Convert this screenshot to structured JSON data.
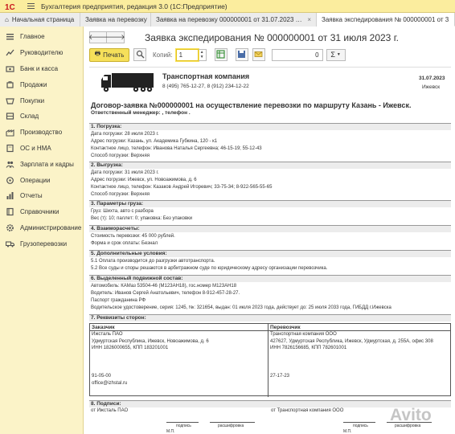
{
  "app": {
    "title": "Бухгалтерия предприятия, редакция 3.0  (1С:Предприятие)"
  },
  "tabs": [
    {
      "label": "Начальная страница",
      "closable": false
    },
    {
      "label": "Заявка на перевозку",
      "closable": true
    },
    {
      "label": "Заявка на перевозку 000000001 от 31.07.2023 14:57:45",
      "closable": true
    },
    {
      "label": "Заявка экспедирования № 000000001 от 31 июля 2023 г.",
      "closable": true
    }
  ],
  "sidebar": {
    "items": [
      {
        "label": "Главное",
        "icon": "menu-icon"
      },
      {
        "label": "Руководителю",
        "icon": "chart-icon"
      },
      {
        "label": "Банк и касса",
        "icon": "bank-icon"
      },
      {
        "label": "Продажи",
        "icon": "cart-icon"
      },
      {
        "label": "Покупки",
        "icon": "basket-icon"
      },
      {
        "label": "Склад",
        "icon": "warehouse-icon"
      },
      {
        "label": "Производство",
        "icon": "factory-icon"
      },
      {
        "label": "ОС и НМА",
        "icon": "building-icon"
      },
      {
        "label": "Зарплата и кадры",
        "icon": "people-icon"
      },
      {
        "label": "Операции",
        "icon": "operations-icon"
      },
      {
        "label": "Отчеты",
        "icon": "report-icon"
      },
      {
        "label": "Справочники",
        "icon": "book-icon"
      },
      {
        "label": "Администрирование",
        "icon": "gear-icon"
      },
      {
        "label": "Грузоперевозки",
        "icon": "truck-icon"
      }
    ]
  },
  "form": {
    "title": "Заявка экспедирования № 000000001 от 31 июля 2023 г.",
    "print_label": "Печать",
    "copies_label": "Копий:",
    "copies_value": "1",
    "sum_value": "0",
    "sigma": "Σ"
  },
  "document": {
    "company_name": "Транспортная компания",
    "company_phones": "8 (495) 765-12-27, 8 (912) 234-12-22",
    "date": "31.07.2023",
    "city": "Ижевск",
    "contract_title": "Договор-заявка №000000001 на осуществление перевозки по маршруту Казань - Ижевск.",
    "manager": "Ответственный менеджер: , телефон .",
    "sections": [
      {
        "title": "1. Погрузка:",
        "lines": [
          "Дата погрузки: 28 июля 2023 г.",
          "Адрес погрузки: Казань, ул. Академика Губкина, 120 - к1",
          "Контактное лицо, телефон: Иванова Наталья Сергеевна; 46-15-19; 55-12-43",
          "Способ погрузки: Верхняя"
        ]
      },
      {
        "title": "2. Выгрузка:",
        "lines": [
          "Дата погрузки: 31 июля 2023 г.",
          "Адрес погрузки: Ижевск, ул. Новоажимова, д. 6",
          "Контактное лицо, телефон: Казаков Андрей Игоревич; 33-75-34; 8-922-565-55-65",
          "Способ погрузки: Верхняя"
        ]
      },
      {
        "title": "3. Параметры груза:",
        "lines": [
          "Груз: Шихта, авто с разбора",
          "Вес (т): 10; паллет: 0; упаковка: Без упаковки"
        ]
      },
      {
        "title": "4. Взаиморасчеты:",
        "lines": [
          "Стоимость перевозки: 45 000 рублей.",
          "Форма и срок оплаты: Безнал"
        ]
      },
      {
        "title": "5. Дополнительные условия:",
        "lines": [
          "5.1 Оплата производится до разгрузки автотранспорта.",
          "5.2 Все суды и споры решаются в арбитражном суде по юридическому адресу организации перевозчика."
        ]
      },
      {
        "title": "6. Выделенный подвижной состав:",
        "lines": [
          "Автомобиль: КАМаз 53504-46 (М123АН18), гос.номер М123АН18",
          "Водитель: Иванов Сергей Анатольевич, телефон 8-912-457-28-27.",
          "Паспорт гражданина РФ",
          "Водительское удостоверение, серия: 1245, №: 321654, выдан: 01 июля 2023 года, действует до: 25 июля 2033 года, ГИБДД г.Ижевска"
        ]
      }
    ],
    "requisites": {
      "title": "7. Реквизиты сторон:",
      "customer": {
        "header": "Заказчик",
        "lines": [
          "Ижсталь ПАО",
          "Удмуртская Республика, Ижевск, Новоажимова, д. 6",
          "ИНН 1826000655, КПП 183201001"
        ],
        "phone": "91-05-00",
        "email": "office@izhstal.ru"
      },
      "carrier": {
        "header": "Перевозчик",
        "lines": [
          "Транспортная компания ООО",
          "427627, Удмуртская Республика, Ижевск, Удмуртская, д. 255А, офис 308",
          "ИНН 7826156685, КПП 782601001"
        ],
        "phone": "27-17-23"
      }
    },
    "signatures": {
      "title": "8. Подписи:",
      "customer": "от Ижсталь ПАО",
      "carrier": "от Транспортная компания ООО",
      "sign_label": "подпись",
      "decode_label": "расшифровка",
      "stamp_label": "М.П."
    }
  },
  "watermark": "Avito"
}
